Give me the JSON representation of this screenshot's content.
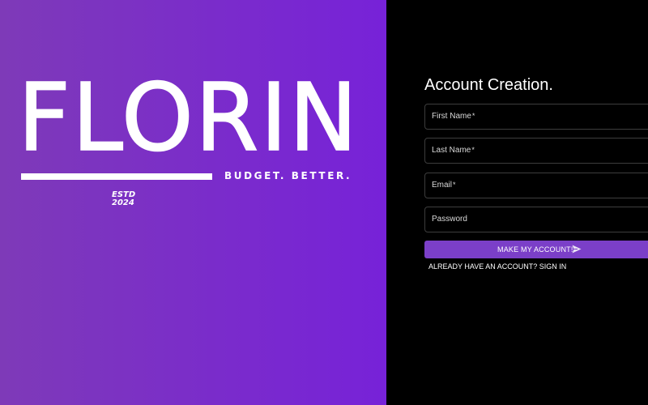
{
  "brand": {
    "logo_word": "FLORIN",
    "tagline": "BUDGET. BETTER.",
    "estd_line1": "ESTD",
    "estd_line2": "2024",
    "colors": {
      "gradient_start": "#7e3ab8",
      "gradient_end": "#7722d8",
      "logo": "#ffffff"
    }
  },
  "form": {
    "title": "Account Creation.",
    "fields": [
      {
        "label": "First Name",
        "required": "*",
        "value": ""
      },
      {
        "label": "Last Name",
        "required": "*",
        "value": ""
      },
      {
        "label": "Email",
        "required": "*",
        "value": ""
      },
      {
        "label": "Password",
        "required": "",
        "value": ""
      }
    ],
    "submit_label": "MAKE MY ACCOUNT!",
    "submit_icon": "send-icon",
    "signin_link": "ALREADY HAVE AN ACCOUNT? SIGN IN",
    "colors": {
      "background": "#000000",
      "accent": "#7b3fc8",
      "field_border": "#3d3d3d"
    }
  }
}
